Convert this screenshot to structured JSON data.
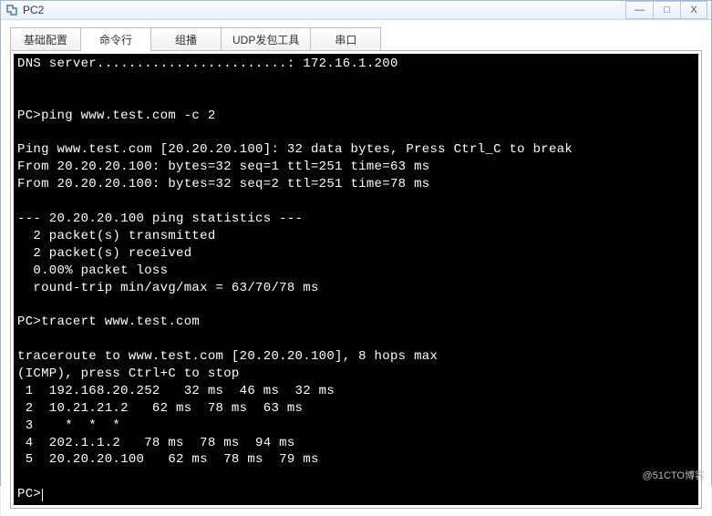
{
  "window": {
    "title": "PC2",
    "icon_name": "app-icon"
  },
  "controls": {
    "minimize": "—",
    "maximize": "□",
    "close": "X"
  },
  "tabs": [
    {
      "label": "基础配置",
      "active": false
    },
    {
      "label": "命令行",
      "active": true
    },
    {
      "label": "组播",
      "active": false
    },
    {
      "label": "UDP发包工具",
      "active": false
    },
    {
      "label": "串口",
      "active": false
    }
  ],
  "terminal": {
    "lines": [
      "DNS server........................: 172.16.1.200",
      "",
      "",
      "PC>ping www.test.com -c 2",
      "",
      "Ping www.test.com [20.20.20.100]: 32 data bytes, Press Ctrl_C to break",
      "From 20.20.20.100: bytes=32 seq=1 ttl=251 time=63 ms",
      "From 20.20.20.100: bytes=32 seq=2 ttl=251 time=78 ms",
      "",
      "--- 20.20.20.100 ping statistics ---",
      "  2 packet(s) transmitted",
      "  2 packet(s) received",
      "  0.00% packet loss",
      "  round-trip min/avg/max = 63/70/78 ms",
      "",
      "PC>tracert www.test.com",
      "",
      "traceroute to www.test.com [20.20.20.100], 8 hops max",
      "(ICMP), press Ctrl+C to stop",
      " 1  192.168.20.252   32 ms  46 ms  32 ms",
      " 2  10.21.21.2   62 ms  78 ms  63 ms",
      " 3    *  *  *",
      " 4  202.1.1.2   78 ms  78 ms  94 ms",
      " 5  20.20.20.100   62 ms  78 ms  79 ms",
      "",
      "PC>"
    ],
    "prompt_cursor": true
  },
  "watermark": "@51CTO博客"
}
